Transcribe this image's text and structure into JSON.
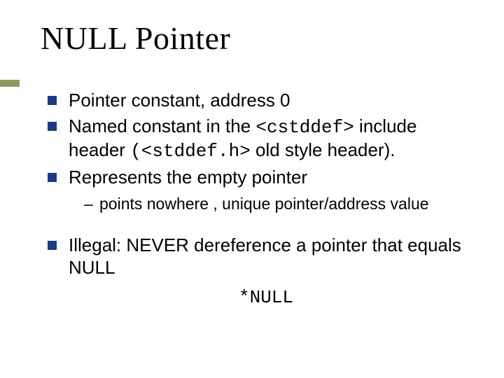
{
  "title": "NULL Pointer",
  "bullets": {
    "b1": "Pointer constant, address 0",
    "b2a": "Named constant in the ",
    "b2code1": "<cstddef>",
    "b2b": " include header ",
    "b2code2": "(<stddef.h>",
    "b2c": " old style header).",
    "b3": "Represents the empty pointer",
    "b3sub": "points nowhere , unique pointer/address value",
    "b4": "Illegal: NEVER dereference a pointer that equals NULL",
    "b4code": "*NULL"
  }
}
